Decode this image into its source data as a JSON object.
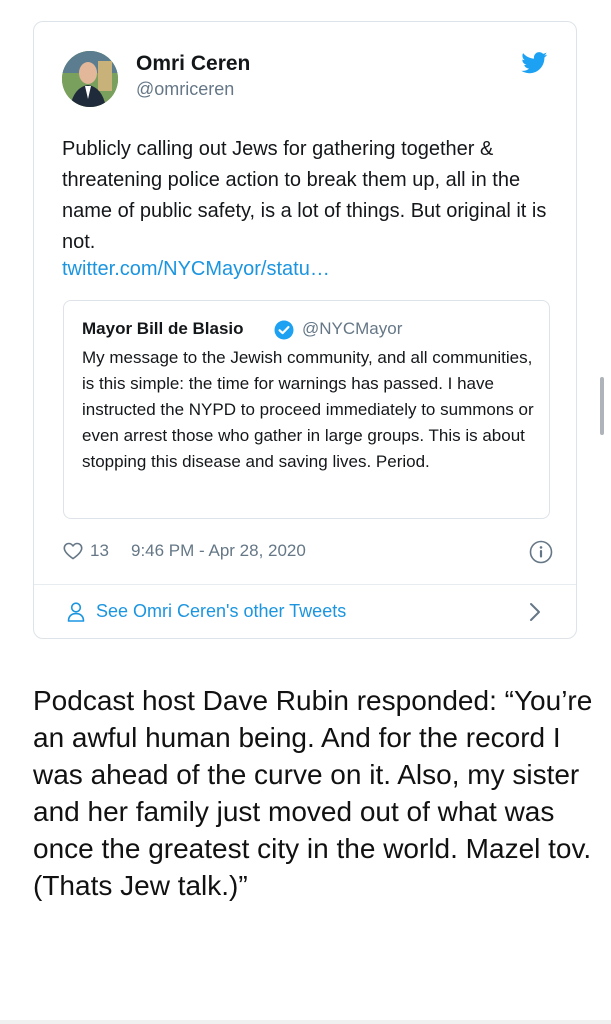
{
  "tweet": {
    "author_name": "Omri Ceren",
    "author_handle": "@omriceren",
    "text": "Publicly calling out Jews for gathering together & threatening police action to break them up, all in the name of public safety, is a lot of things. But original it is not.",
    "link": "twitter.com/NYCMayor/statu…",
    "quote": {
      "author_name": "Mayor Bill de Blasio",
      "author_handle": "@NYCMayor",
      "text": "My message to the Jewish community, and all communities, is this simple: the time for warnings has passed. I have instructed the NYPD to proceed immediately to summons or even arrest those who gather in large groups. This is about stopping this disease and saving lives. Period."
    },
    "likes": "13",
    "timestamp": "9:46 PM - Apr 28, 2020",
    "footer_label": "See Omri Ceren's other Tweets"
  },
  "article": {
    "text": "Podcast host Dave Rubin responded: “You’re an awful human being. And for the record I was ahead of the curve on it. Also, my sister and her family just moved out of what was once the greatest city in the world. Mazel tov. (Thats Jew talk.)”"
  },
  "colors": {
    "twitter_blue": "#1da1f2",
    "link_blue": "#1b95e0",
    "secondary_text": "#657786",
    "border": "#dde3e8"
  }
}
